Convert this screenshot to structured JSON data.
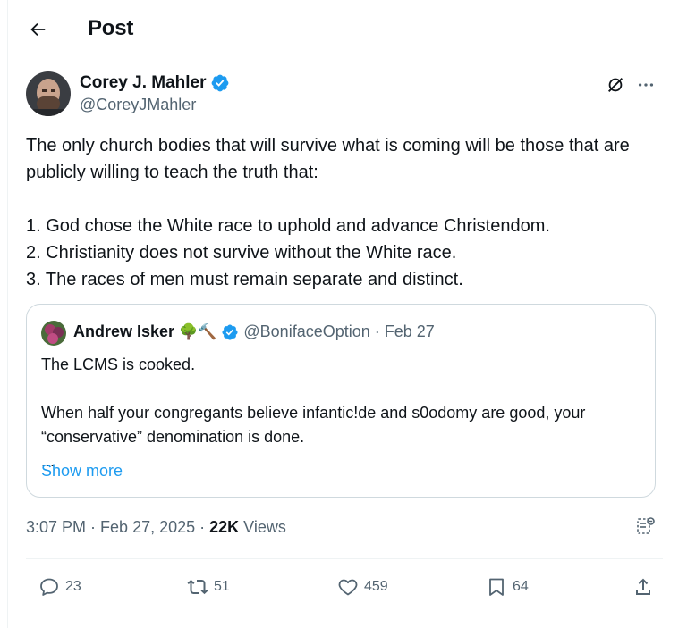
{
  "header": {
    "title": "Post"
  },
  "author": {
    "name": "Corey J. Mahler",
    "handle": "@CoreyJMahler"
  },
  "post": {
    "text": "The only church bodies that will survive what is coming will be those that are publicly willing to teach the truth that:\n\n1. God chose the White race to uphold and advance Christendom.\n2. Christianity does not survive without the White race.\n3. The races of men must remain separate and distinct."
  },
  "quote": {
    "name": "Andrew Isker",
    "emoji": "🌳🔨",
    "handle": "@BonifaceOption",
    "separator": "·",
    "date": "Feb 27",
    "text": "The LCMS is cooked.\n\nWhen half your congregants believe infantic!de and s0odomy are good, your “conservative” denomination is done.\n...",
    "show_more": "Show more"
  },
  "meta": {
    "time": "3:07 PM",
    "separator": "·",
    "date": "Feb 27, 2025",
    "separator2": "·",
    "views_count": "22K",
    "views_label": "Views"
  },
  "actions": {
    "replies": "23",
    "reposts": "51",
    "likes": "459",
    "bookmarks": "64"
  },
  "colors": {
    "accent": "#1d9bf0",
    "secondary_text": "#536471",
    "primary_text": "#0f1419",
    "border": "#cfd9de"
  }
}
